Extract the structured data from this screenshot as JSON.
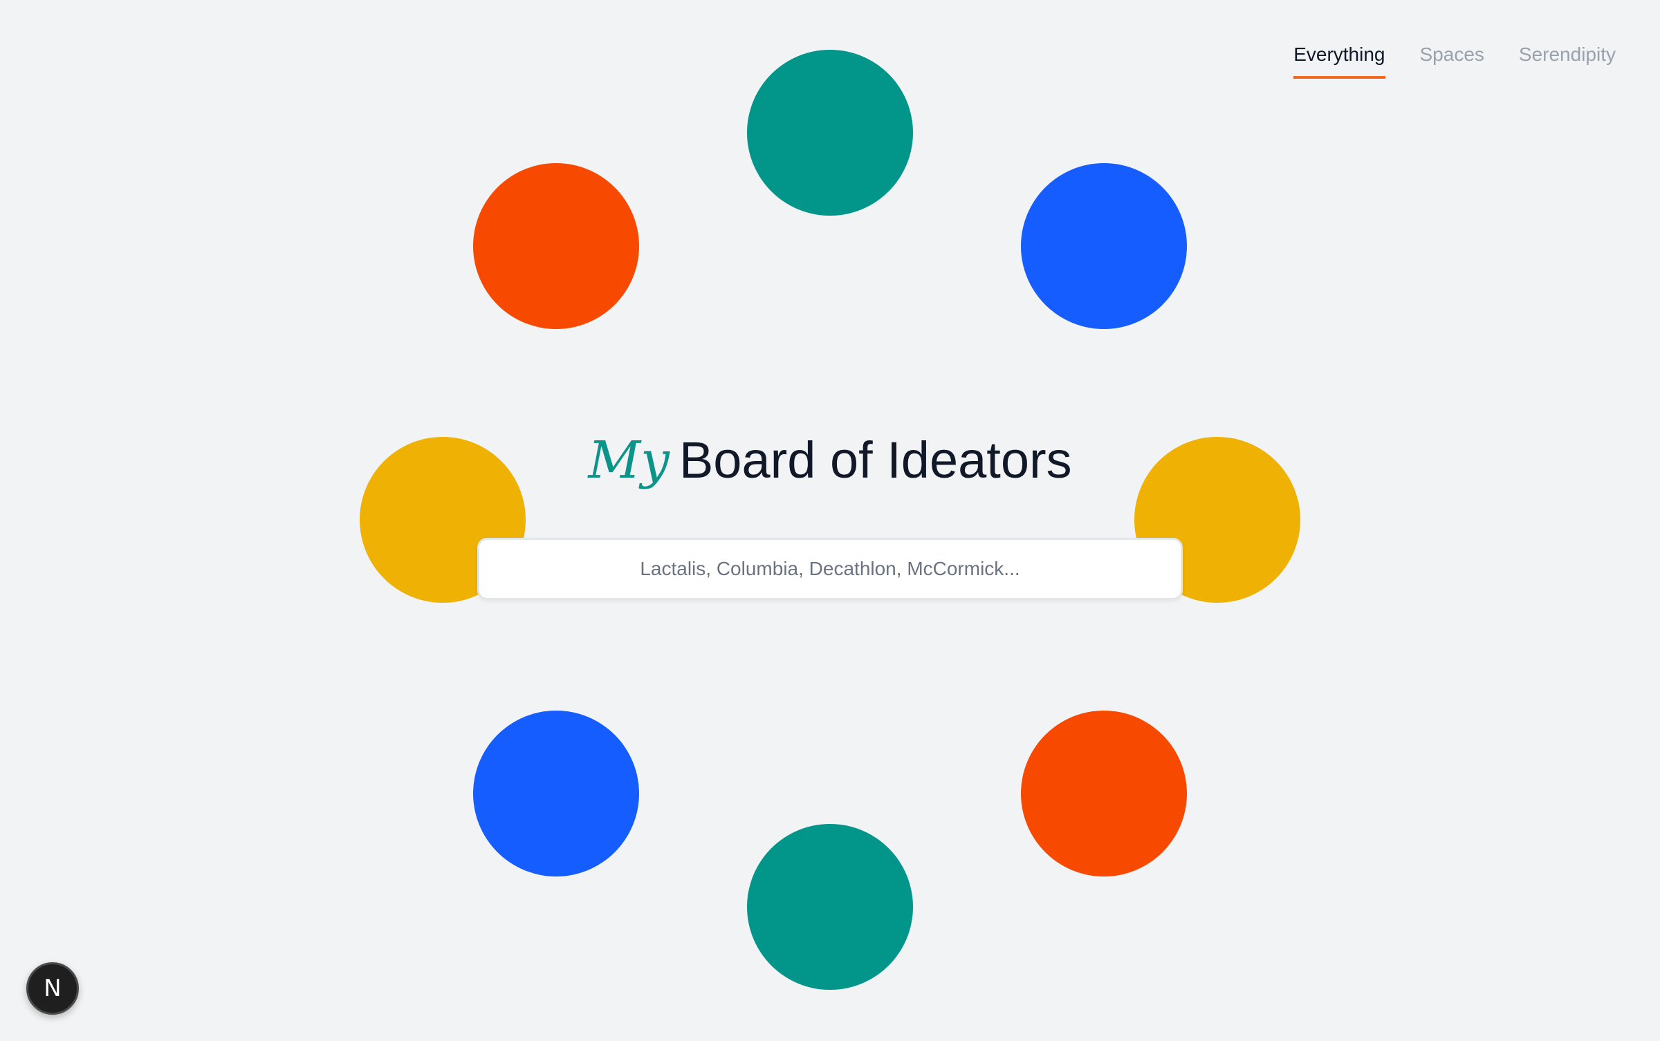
{
  "nav": {
    "tabs": [
      {
        "label": "Everything",
        "active": true
      },
      {
        "label": "Spaces",
        "active": false
      },
      {
        "label": "Serendipity",
        "active": false
      }
    ],
    "accent_color": "#f26a21"
  },
  "hero": {
    "title_em": "My",
    "title_rest": "Board of Ideators",
    "title_em_color": "#0d948a"
  },
  "search": {
    "value": "",
    "placeholder": "Lactalis, Columbia, Decathlon, McCormick..."
  },
  "circles": [
    {
      "name": "circle-top",
      "color": "#02968a"
    },
    {
      "name": "circle-top-right",
      "color": "#165dff"
    },
    {
      "name": "circle-right",
      "color": "#efb103"
    },
    {
      "name": "circle-bottom-right",
      "color": "#f74a00"
    },
    {
      "name": "circle-bottom",
      "color": "#02968a"
    },
    {
      "name": "circle-bottom-left",
      "color": "#165dff"
    },
    {
      "name": "circle-left",
      "color": "#efb103"
    },
    {
      "name": "circle-top-left",
      "color": "#f74a00"
    }
  ],
  "badge": {
    "label": "N",
    "icon": "nextjs-logo-icon"
  }
}
